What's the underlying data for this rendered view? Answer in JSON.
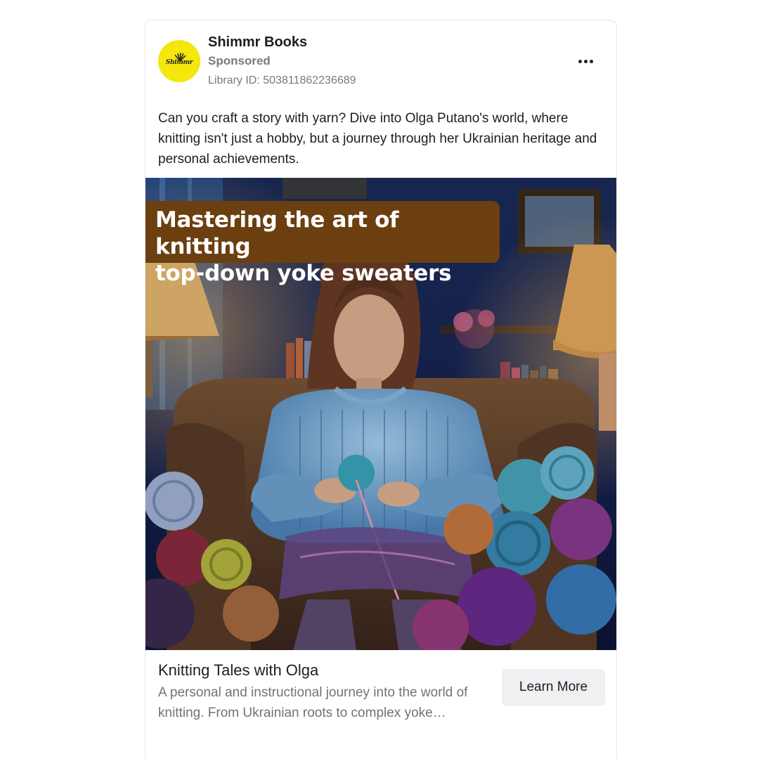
{
  "advertiser": {
    "name": "Shimmr Books",
    "sponsored_label": "Sponsored",
    "library_id": "Library ID: 503811862236689",
    "avatar_text": "Shimmr",
    "avatar_color": "#f5e60b"
  },
  "menu": {
    "icon": "more-horizontal-icon"
  },
  "post": {
    "body": "Can you craft a story with yarn? Dive into Olga Putano's world, where knitting isn't just a hobby, but a journey through her Ukrainian heritage and personal achievements."
  },
  "creative": {
    "overlay_line1": "Mastering the art of knitting",
    "overlay_line2": "top-down yoke sweaters",
    "overlay_color": "#6b3f10"
  },
  "link": {
    "headline": "Knitting Tales with Olga",
    "description": "A personal and instructional journey into the world of knitting. From Ukrainian roots to complex yoke…",
    "cta_label": "Learn More"
  }
}
